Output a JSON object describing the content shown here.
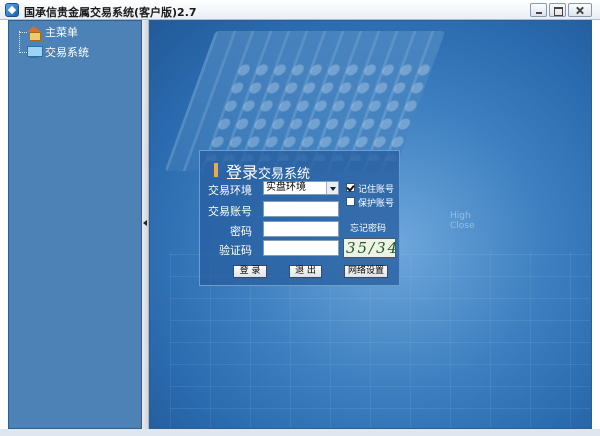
{
  "window": {
    "title": "国承信贵金属交易系统(客户版)2.7"
  },
  "sidebar": {
    "items": [
      {
        "label": "主菜单",
        "icon": "home-icon"
      },
      {
        "label": "交易系统",
        "icon": "computer-icon"
      }
    ]
  },
  "background": {
    "deco_label": "High\nClose"
  },
  "login": {
    "title": "登录",
    "subtitle": "交易系统",
    "env_label": "交易环境",
    "env_value": "实盘环境",
    "account_label": "交易账号",
    "password_label": "密码",
    "code_label": "验证码",
    "remember_label": "记住账号",
    "remember_checked": true,
    "protect_label": "保护账号",
    "protect_checked": false,
    "forgot_label": "忘记密码",
    "captcha_value": "35/34",
    "login_button": "登 录",
    "exit_button": "退 出",
    "network_button": "网络设置"
  }
}
